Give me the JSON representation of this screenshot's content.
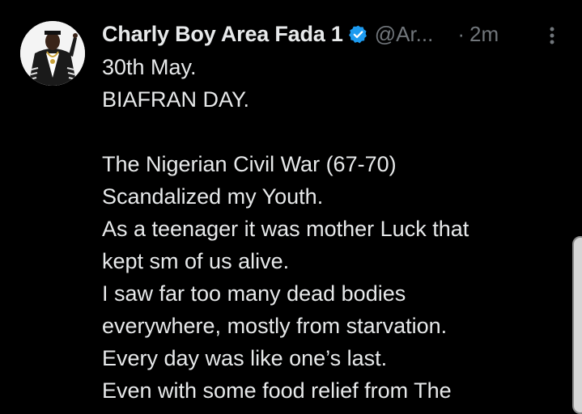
{
  "tweet": {
    "display_name": "Charly Boy Area Fada 1",
    "handle": "@Ar...",
    "separator": "·",
    "time": "2m",
    "verified_color": "#1d9bf0",
    "lines": [
      "30th May.",
      "BIAFRAN DAY.",
      "",
      "The Nigerian Civil War (67-70)",
      "Scandalized my Youth.",
      "As a teenager it was mother Luck that",
      "kept sm of us alive.",
      "I saw far too many dead bodies",
      "everywhere, mostly from starvation.",
      "Every day was like one’s last.",
      "Even with some food relief from The"
    ]
  },
  "icons": {
    "verified": "verified-badge-icon",
    "more": "more-options-icon"
  }
}
